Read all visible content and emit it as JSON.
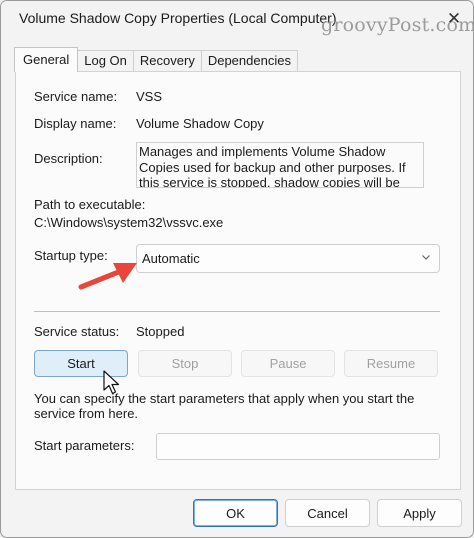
{
  "window": {
    "title": "Volume Shadow Copy Properties (Local Computer)",
    "close_glyph": "✕",
    "watermark": "groovyPost.com"
  },
  "tabs": [
    {
      "label": "General",
      "active": true
    },
    {
      "label": "Log On",
      "active": false
    },
    {
      "label": "Recovery",
      "active": false
    },
    {
      "label": "Dependencies",
      "active": false
    }
  ],
  "general": {
    "service_name_label": "Service name:",
    "service_name_value": "VSS",
    "display_name_label": "Display name:",
    "display_name_value": "Volume Shadow Copy",
    "description_label": "Description:",
    "description_value": "Manages and implements Volume Shadow Copies used for backup and other purposes. If this service is stopped, shadow copies will be unavailable for",
    "path_label": "Path to executable:",
    "path_value": "C:\\Windows\\system32\\vssvc.exe",
    "startup_label": "Startup type:",
    "startup_value": "Automatic",
    "status_label": "Service status:",
    "status_value": "Stopped"
  },
  "service_buttons": {
    "start": "Start",
    "stop": "Stop",
    "pause": "Pause",
    "resume": "Resume"
  },
  "help_text": "You can specify the start parameters that apply when you start the service from here.",
  "start_params": {
    "label": "Start parameters:",
    "value": ""
  },
  "footer": {
    "ok": "OK",
    "cancel": "Cancel",
    "apply": "Apply"
  },
  "colors": {
    "annotation_arrow": "#e8453c",
    "focus_button_bg": "#e0eef9",
    "primary_border": "#2f73b8"
  },
  "icons": {
    "close": "close-icon",
    "dropdown": "chevron-down-icon",
    "annotation": "red-arrow-annotation",
    "cursor": "mouse-pointer-icon"
  }
}
